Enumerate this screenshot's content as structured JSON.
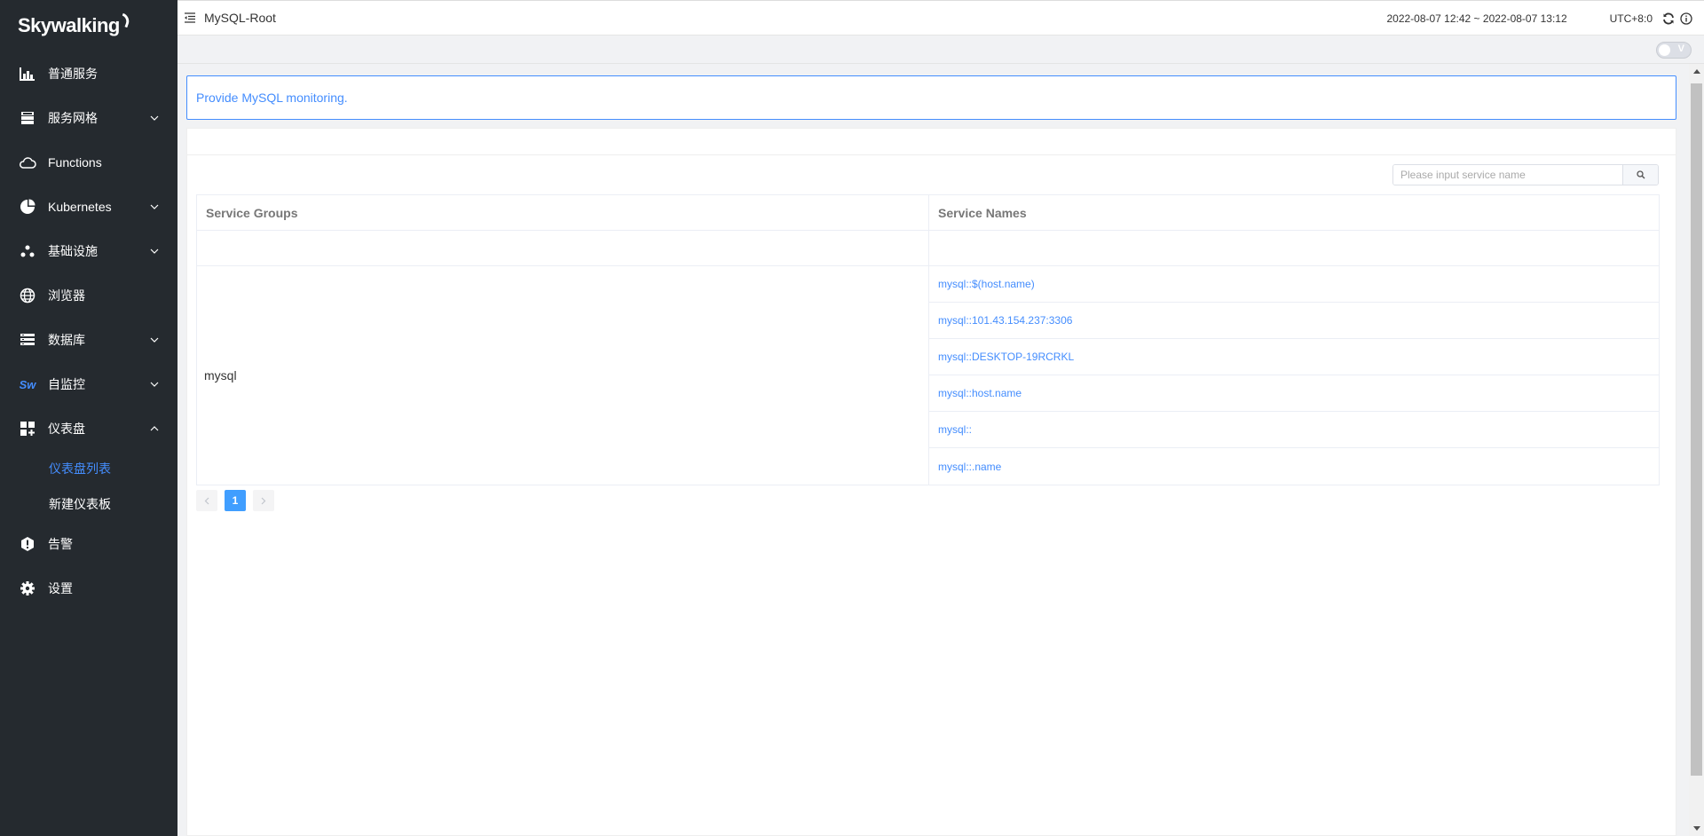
{
  "sidebar": {
    "logo": "Skywalking",
    "items": [
      {
        "label": "普通服务",
        "icon": "chart-icon",
        "chevron": false
      },
      {
        "label": "服务网格",
        "icon": "layers-icon",
        "chevron": true
      },
      {
        "label": "Functions",
        "icon": "cloud-icon",
        "chevron": false
      },
      {
        "label": "Kubernetes",
        "icon": "pie-icon",
        "chevron": true
      },
      {
        "label": "基础设施",
        "icon": "nodes-icon",
        "chevron": true
      },
      {
        "label": "浏览器",
        "icon": "globe-icon",
        "chevron": false
      },
      {
        "label": "数据库",
        "icon": "database-icon",
        "chevron": true
      },
      {
        "label": "自监控",
        "icon": "sw-icon",
        "chevron": true
      },
      {
        "label": "仪表盘",
        "icon": "dashboard-icon",
        "chevron": true,
        "expanded": true
      },
      {
        "label": "告警",
        "icon": "alert-icon",
        "chevron": false
      },
      {
        "label": "设置",
        "icon": "gear-icon",
        "chevron": false
      }
    ],
    "sub_items": [
      {
        "label": "仪表盘列表",
        "active": true
      },
      {
        "label": "新建仪表板",
        "active": false
      }
    ],
    "sw_text": "Sw"
  },
  "header": {
    "title": "MySQL-Root",
    "time_range": "2022-08-07 12:42 ~ 2022-08-07 13:12",
    "timezone": "UTC+8:0"
  },
  "toolbar": {
    "toggle_label": "V"
  },
  "main": {
    "notice": "Provide MySQL monitoring.",
    "search_placeholder": "Please input service name",
    "table": {
      "headers": [
        "Service Groups",
        "Service Names"
      ],
      "group": "mysql",
      "services": [
        "mysql::$(host.name)",
        "mysql::101.43.154.237:3306",
        "mysql::DESKTOP-19RCRKL",
        "mysql::host.name",
        "mysql::",
        "mysql::.name"
      ]
    },
    "pagination": {
      "current": "1"
    }
  },
  "colors": {
    "sidebar_bg": "#252a2f",
    "accent": "#448dfe",
    "page_active": "#409eff"
  }
}
